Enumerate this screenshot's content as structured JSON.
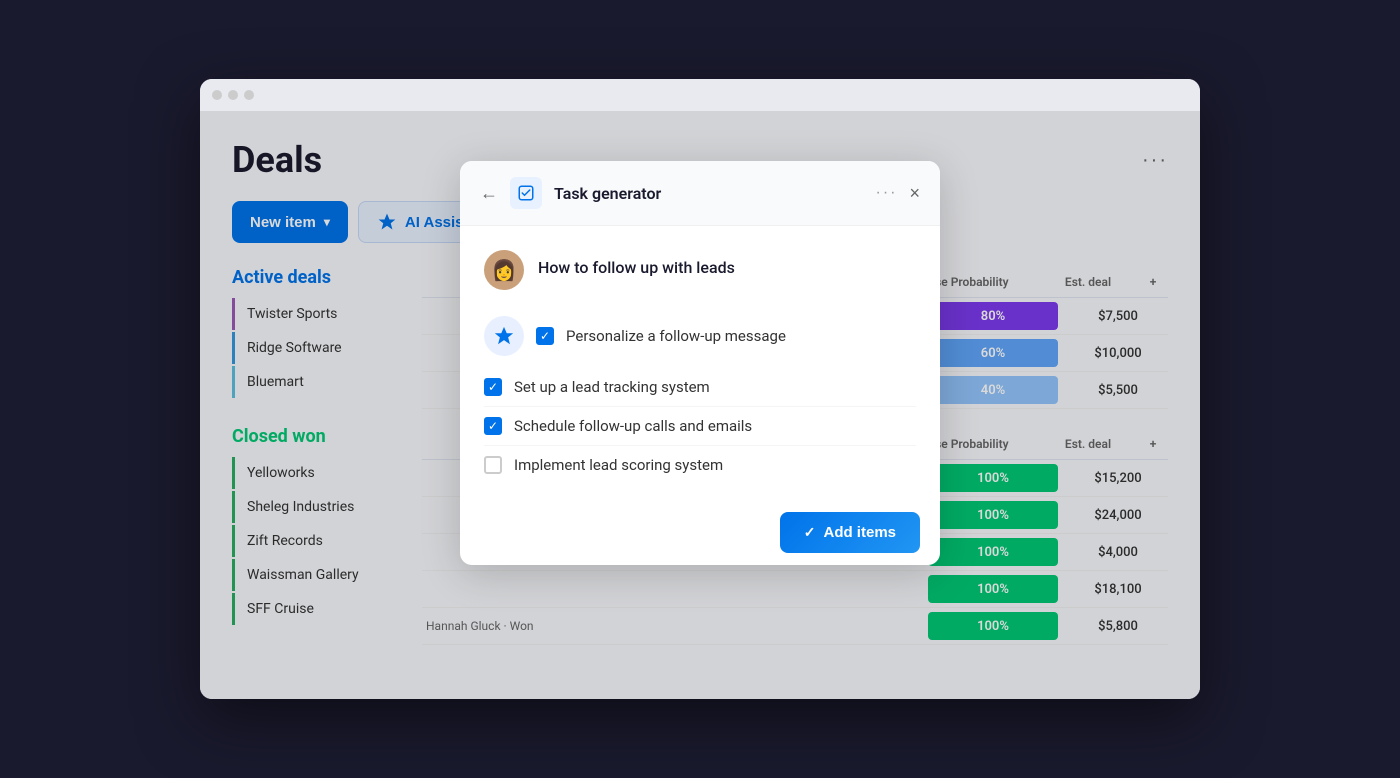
{
  "browser": {
    "dots": [
      "dot1",
      "dot2",
      "dot3"
    ]
  },
  "page": {
    "title": "Deals",
    "more_label": "···"
  },
  "toolbar": {
    "new_item_label": "New item",
    "ai_assistant_label": "AI Assistant"
  },
  "active_deals": {
    "section_label": "Active deals",
    "items": [
      {
        "name": "Twister Sports",
        "class": "active-1"
      },
      {
        "name": "Ridge Software",
        "class": "active-2"
      },
      {
        "name": "Bluemart",
        "class": "active-3"
      }
    ]
  },
  "closed_won": {
    "section_label": "Closed won",
    "items": [
      {
        "name": "Yelloworks",
        "class": "won-1"
      },
      {
        "name": "Sheleg Industries",
        "class": "won-2"
      },
      {
        "name": "Zift Records",
        "class": "won-3"
      },
      {
        "name": "Waissman Gallery",
        "class": "won-4"
      },
      {
        "name": "SFF Cruise",
        "class": "won-5"
      }
    ]
  },
  "table_active": {
    "col_prob": "Close Probability",
    "col_deal": "Est. deal",
    "rows": [
      {
        "prob": "80%",
        "prob_class": "prob-80",
        "deal": "$7,500"
      },
      {
        "prob": "60%",
        "prob_class": "prob-60",
        "deal": "$10,000"
      },
      {
        "prob": "40%",
        "prob_class": "prob-40",
        "deal": "$5,500"
      }
    ]
  },
  "table_won": {
    "col_prob": "Close Probability",
    "col_deal": "Est. deal",
    "rows": [
      {
        "prob": "100%",
        "prob_class": "prob-100",
        "deal": "$15,200"
      },
      {
        "prob": "100%",
        "prob_class": "prob-100",
        "deal": "$24,000"
      },
      {
        "prob": "100%",
        "prob_class": "prob-100",
        "deal": "$4,000"
      },
      {
        "prob": "100%",
        "prob_class": "prob-100",
        "deal": "$18,100"
      },
      {
        "prob": "100%",
        "prob_class": "prob-100",
        "deal": "$5,800",
        "extra": "Hannah Gluck · Won"
      }
    ]
  },
  "modal": {
    "title": "Task generator",
    "back_label": "←",
    "more_label": "···",
    "close_label": "×",
    "prompt": "How to follow up with leads",
    "tasks": [
      {
        "text": "Personalize a follow-up message",
        "checked": true,
        "ai": true
      },
      {
        "text": "Set up a lead tracking system",
        "checked": true,
        "ai": false
      },
      {
        "text": "Schedule follow-up calls and emails",
        "checked": true,
        "ai": false
      },
      {
        "text": "Implement lead scoring system",
        "checked": false,
        "ai": false
      }
    ],
    "add_items_label": "Add items"
  }
}
